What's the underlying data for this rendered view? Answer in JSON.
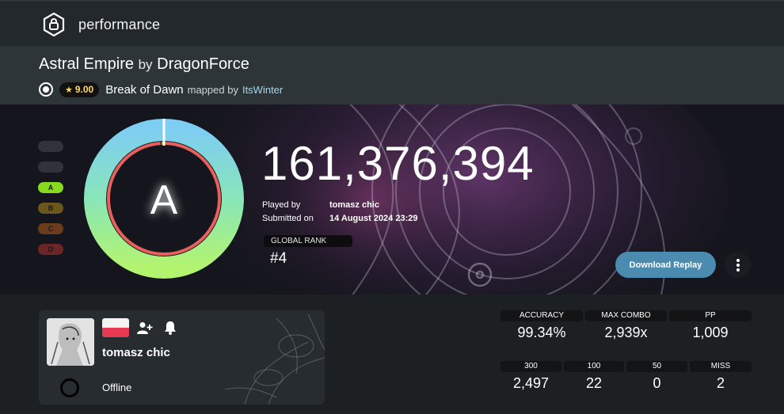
{
  "topbar": {
    "title": "performance",
    "logo_icon": "ruleset-icon"
  },
  "beatmap": {
    "title": "Astral Empire",
    "by": "by",
    "artist": "DragonForce",
    "star_rating": "9.00",
    "difficulty": "Break of Dawn",
    "mapped_by": "mapped by",
    "mapper": "ItsWinter"
  },
  "score": {
    "grade": "A",
    "total": "161,376,394",
    "played_by_label": "Played by",
    "played_by": "tomasz chic",
    "submitted_label": "Submitted on",
    "submitted": "14 August 2024 23:29",
    "global_rank_label": "GLOBAL RANK",
    "global_rank": "#4",
    "grades": [
      {
        "label": "",
        "color": "#3a3f44",
        "active": false
      },
      {
        "label": "",
        "color": "#3a3f44",
        "active": false
      },
      {
        "label": "A",
        "color": "#88da20",
        "active": true
      },
      {
        "label": "B",
        "color": "#8a6d1c",
        "active": false
      },
      {
        "label": "C",
        "color": "#8a4a1c",
        "active": false
      },
      {
        "label": "D",
        "color": "#8a2a2a",
        "active": false
      }
    ],
    "accuracy_fraction": 0.9934
  },
  "actions": {
    "download_label": "Download Replay"
  },
  "user": {
    "name": "tomasz chic",
    "status": "Offline"
  },
  "stats": {
    "accuracy_label": "ACCURACY",
    "accuracy": "99.34%",
    "max_combo_label": "MAX COMBO",
    "max_combo": "2,939x",
    "pp_label": "PP",
    "pp": "1,009",
    "c300_label": "300",
    "c300": "2,497",
    "c100_label": "100",
    "c100": "22",
    "c50_label": "50",
    "c50": "0",
    "miss_label": "MISS",
    "miss": "2"
  },
  "colors": {
    "accent": "#4c8bb0",
    "ring_gradient": [
      "#7ecdf2",
      "#88e6b9",
      "#b3f46f"
    ],
    "accuracy_arc": "#e8605c"
  }
}
